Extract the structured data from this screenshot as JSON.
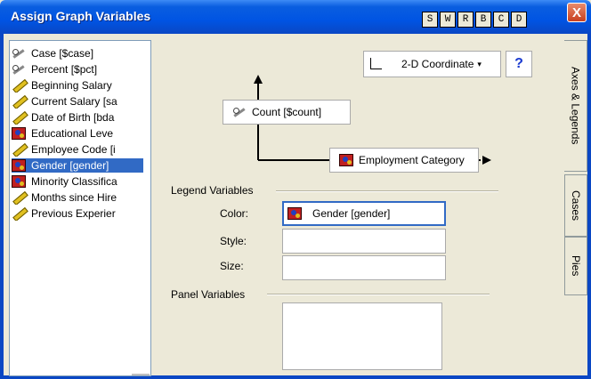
{
  "window": {
    "title": "Assign Graph Variables",
    "toolbar_buttons": [
      "S",
      "W",
      "R",
      "B",
      "C",
      "D"
    ],
    "close_label": "X"
  },
  "variables": [
    {
      "label": "Case [$case]",
      "icon": "scissors-icon",
      "selected": false
    },
    {
      "label": "Percent [$pct]",
      "icon": "scissors-icon",
      "selected": false
    },
    {
      "label": "Beginning Salary",
      "icon": "ruler-icon",
      "selected": false
    },
    {
      "label": "Current Salary [sa",
      "icon": "ruler-icon",
      "selected": false
    },
    {
      "label": "Date of Birth [bda",
      "icon": "ruler-icon",
      "selected": false
    },
    {
      "label": "Educational Leve",
      "icon": "nominal-icon",
      "selected": false
    },
    {
      "label": "Employee Code [i",
      "icon": "ruler-icon",
      "selected": false
    },
    {
      "label": "Gender [gender]",
      "icon": "nominal-icon",
      "selected": true
    },
    {
      "label": "Minority Classifica",
      "icon": "nominal-icon",
      "selected": false
    },
    {
      "label": "Months since Hire",
      "icon": "ruler-icon",
      "selected": false
    },
    {
      "label": "Previous Experier",
      "icon": "ruler-icon",
      "selected": false
    }
  ],
  "coordinate": {
    "label": "2-D Coordinate",
    "caret": "▾",
    "help_label": "?"
  },
  "axes": {
    "y_variable": {
      "label": "Count [$count]",
      "icon": "scissors-icon"
    },
    "x_variable": {
      "label": "Employment Category",
      "icon": "nominal-icon"
    }
  },
  "legend": {
    "section_label": "Legend Variables",
    "color_label": "Color:",
    "color_value": "Gender [gender]",
    "style_label": "Style:",
    "size_label": "Size:"
  },
  "panel": {
    "section_label": "Panel Variables"
  },
  "tabs": [
    "Axes & Legends",
    "Cases",
    "Pies"
  ],
  "colors": {
    "titlebar": "#0054e3",
    "selection": "#316ac5",
    "dialog_bg": "#ece9d8",
    "help_icon": "#1a3ad0"
  }
}
